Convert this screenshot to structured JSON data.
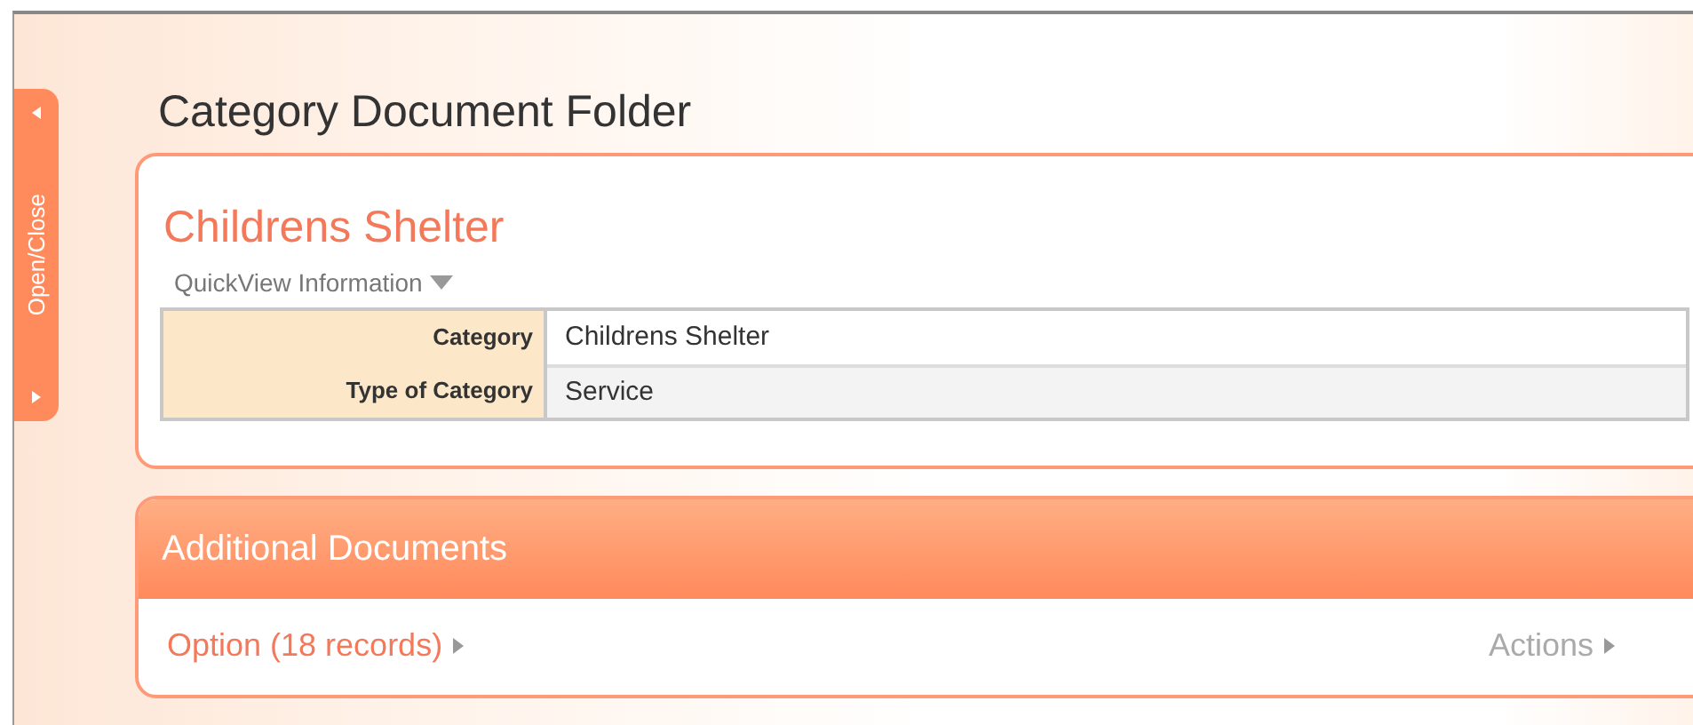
{
  "side_tab": {
    "label": "Open/Close"
  },
  "page_title": "Category Document Folder",
  "record": {
    "title": "Childrens Shelter",
    "quickview": {
      "label": "QuickView Information",
      "expanded": true
    },
    "fields": [
      {
        "label": "Category",
        "value": "Childrens Shelter"
      },
      {
        "label": "Type of Category",
        "value": "Service"
      }
    ]
  },
  "section": {
    "title": "Additional Documents",
    "option": "Option (18 records)",
    "actions": "Actions"
  }
}
